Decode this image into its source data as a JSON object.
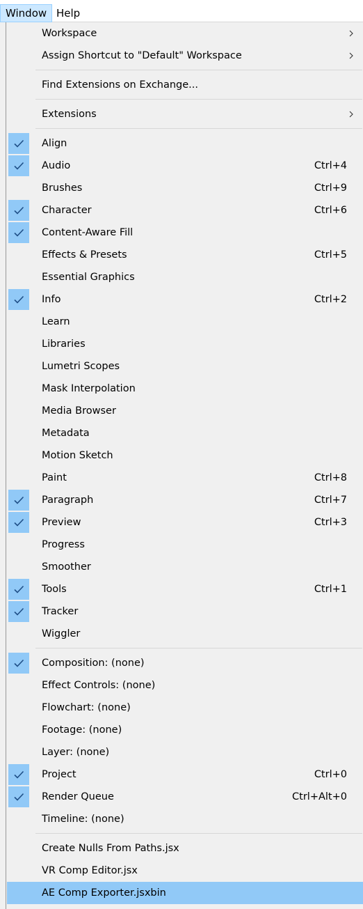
{
  "menubar": {
    "items": [
      {
        "label": "Window",
        "open": true
      },
      {
        "label": "Help",
        "open": false
      }
    ]
  },
  "colors": {
    "menu_background": "#f0f0f0",
    "highlight": "#91c9f7",
    "menubar_open_fill": "#cce8ff",
    "menubar_open_border": "#99d1ff",
    "separator": "#d7d7d7",
    "checkmark": "#1f4f87"
  },
  "menu": {
    "groups": [
      {
        "items": [
          {
            "label": "Workspace",
            "submenu": true
          },
          {
            "label": "Assign Shortcut to \"Default\" Workspace",
            "submenu": true
          }
        ]
      },
      {
        "items": [
          {
            "label": "Find Extensions on Exchange..."
          }
        ]
      },
      {
        "items": [
          {
            "label": "Extensions",
            "submenu": true
          }
        ]
      },
      {
        "items": [
          {
            "label": "Align",
            "checked": true
          },
          {
            "label": "Audio",
            "checked": true,
            "shortcut": "Ctrl+4"
          },
          {
            "label": "Brushes",
            "shortcut": "Ctrl+9"
          },
          {
            "label": "Character",
            "checked": true,
            "shortcut": "Ctrl+6"
          },
          {
            "label": "Content-Aware Fill",
            "checked": true
          },
          {
            "label": "Effects & Presets",
            "shortcut": "Ctrl+5"
          },
          {
            "label": "Essential Graphics"
          },
          {
            "label": "Info",
            "checked": true,
            "shortcut": "Ctrl+2"
          },
          {
            "label": "Learn"
          },
          {
            "label": "Libraries"
          },
          {
            "label": "Lumetri Scopes"
          },
          {
            "label": "Mask Interpolation"
          },
          {
            "label": "Media Browser"
          },
          {
            "label": "Metadata"
          },
          {
            "label": "Motion Sketch"
          },
          {
            "label": "Paint",
            "shortcut": "Ctrl+8"
          },
          {
            "label": "Paragraph",
            "checked": true,
            "shortcut": "Ctrl+7"
          },
          {
            "label": "Preview",
            "checked": true,
            "shortcut": "Ctrl+3"
          },
          {
            "label": "Progress"
          },
          {
            "label": "Smoother"
          },
          {
            "label": "Tools",
            "checked": true,
            "shortcut": "Ctrl+1"
          },
          {
            "label": "Tracker",
            "checked": true
          },
          {
            "label": "Wiggler"
          }
        ]
      },
      {
        "items": [
          {
            "label": "Composition: (none)",
            "checked": true
          },
          {
            "label": "Effect Controls: (none)"
          },
          {
            "label": "Flowchart: (none)"
          },
          {
            "label": "Footage: (none)"
          },
          {
            "label": "Layer: (none)"
          },
          {
            "label": "Project",
            "checked": true,
            "shortcut": "Ctrl+0"
          },
          {
            "label": "Render Queue",
            "checked": true,
            "shortcut": "Ctrl+Alt+0"
          },
          {
            "label": "Timeline: (none)"
          }
        ]
      },
      {
        "items": [
          {
            "label": "Create Nulls From Paths.jsx"
          },
          {
            "label": "VR Comp Editor.jsx"
          },
          {
            "label": "AE Comp Exporter.jsxbin",
            "highlighted": true
          }
        ]
      }
    ]
  }
}
